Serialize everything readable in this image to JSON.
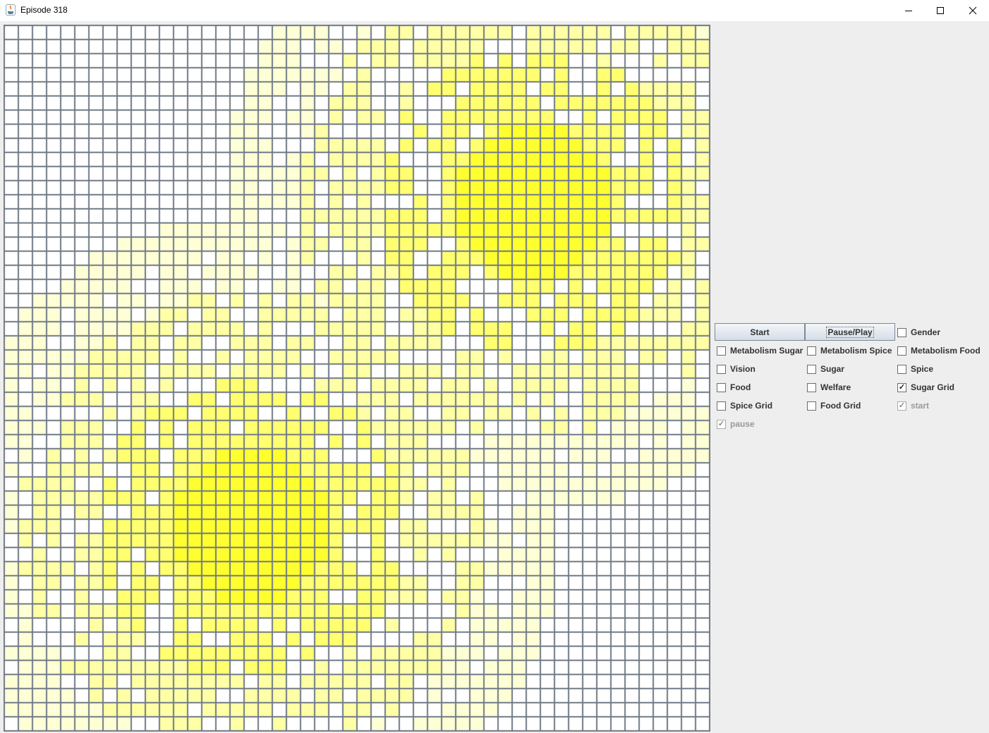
{
  "window": {
    "title": "Episode 318",
    "minimize_glyph": "—",
    "maximize_glyph": "☐",
    "close_glyph": "✕"
  },
  "grid": {
    "rows": 50,
    "cols": 50,
    "line_color": "#6f7a85",
    "empty_color": "#ffffff",
    "sugar_color": "#ffff00"
  },
  "controls": {
    "start_label": "Start",
    "pause_play_label": "Pause/Play",
    "checkboxes": [
      {
        "label": "Gender",
        "checked": false,
        "enabled": true
      },
      {
        "label": "Metabolism Sugar",
        "checked": false,
        "enabled": true
      },
      {
        "label": "Metabolism Spice",
        "checked": false,
        "enabled": true
      },
      {
        "label": "Metabolism Food",
        "checked": false,
        "enabled": true
      },
      {
        "label": "Vision",
        "checked": false,
        "enabled": true
      },
      {
        "label": "Sugar",
        "checked": false,
        "enabled": true
      },
      {
        "label": "Spice",
        "checked": false,
        "enabled": true
      },
      {
        "label": "Food",
        "checked": false,
        "enabled": true
      },
      {
        "label": "Welfare",
        "checked": false,
        "enabled": true
      },
      {
        "label": "Sugar Grid",
        "checked": true,
        "enabled": true
      },
      {
        "label": "Spice Grid",
        "checked": false,
        "enabled": true
      },
      {
        "label": "Food Grid",
        "checked": false,
        "enabled": true
      },
      {
        "label": "start",
        "checked": true,
        "enabled": false
      },
      {
        "label": "pause",
        "checked": true,
        "enabled": false
      }
    ]
  }
}
